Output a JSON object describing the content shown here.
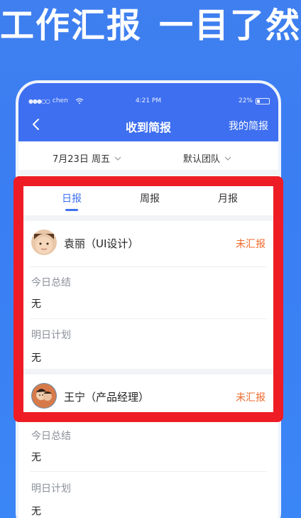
{
  "headline": {
    "part1": "工作汇报",
    "part2": "一目了然"
  },
  "status_bar": {
    "carrier": "chen",
    "time": "4:21 PM",
    "battery": "22%"
  },
  "nav": {
    "title": "收到简报",
    "right_action": "我的简报"
  },
  "filters": {
    "date": "7月23日 周五",
    "team": "默认团队"
  },
  "tabs": [
    {
      "label": "日报",
      "active": true
    },
    {
      "label": "周报",
      "active": false
    },
    {
      "label": "月报",
      "active": false
    }
  ],
  "reports": [
    {
      "name": "袁丽（UI设计）",
      "status": "未汇报",
      "summary_label": "今日总结",
      "summary_value": "无",
      "plan_label": "明日计划",
      "plan_value": "无"
    },
    {
      "name": "王宁（产品经理）",
      "status": "未汇报",
      "summary_label": "今日总结",
      "summary_value": "无",
      "plan_label": "明日计划",
      "plan_value": "无"
    }
  ],
  "colors": {
    "accent": "#3e6ff0",
    "warning": "#f06a2c",
    "highlight": "#ee1c25",
    "background": "#3a7ef3"
  }
}
